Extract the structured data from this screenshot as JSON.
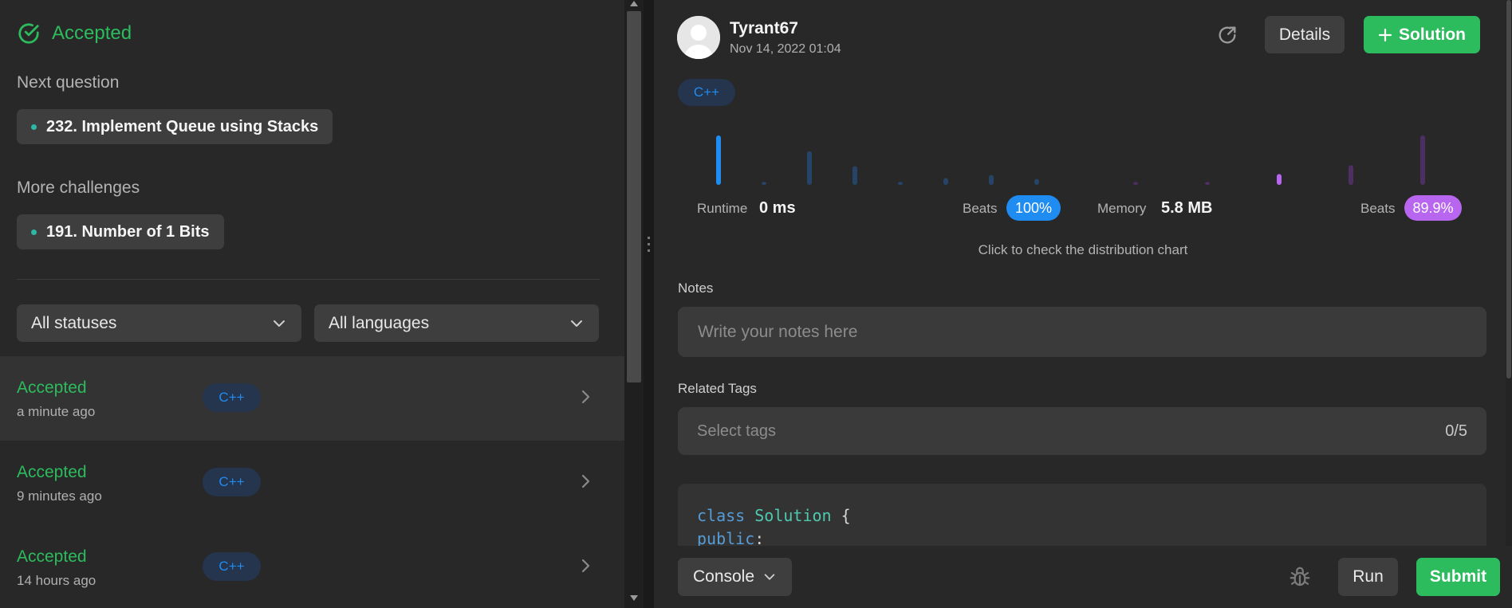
{
  "colors": {
    "accepted_green": "#2cbb5d",
    "lang_blue": "#1f8cf2",
    "runtime_beats": "#1f8cf2",
    "memory_beats": "#b865f0",
    "panel": "#282828"
  },
  "result": {
    "status": "Accepted",
    "icon": "check-circle-icon"
  },
  "next_question": {
    "label": "Next question",
    "title": "232. Implement Queue using Stacks"
  },
  "more_challenges": {
    "label": "More challenges",
    "title": "191. Number of 1 Bits"
  },
  "filters": {
    "status": "All statuses",
    "language": "All languages"
  },
  "submissions": [
    {
      "status": "Accepted",
      "time": "a minute ago",
      "lang": "C++",
      "selected": true
    },
    {
      "status": "Accepted",
      "time": "9 minutes ago",
      "lang": "C++",
      "selected": false
    },
    {
      "status": "Accepted",
      "time": "14 hours ago",
      "lang": "C++",
      "selected": false
    }
  ],
  "detail": {
    "username": "Tyrant67",
    "date": "Nov 14, 2022 01:04",
    "details_label": "Details",
    "solution_label": "Solution",
    "lang": "C++"
  },
  "runtime": {
    "label": "Runtime",
    "value": "0 ms",
    "beats_label": "Beats",
    "beats": "100%"
  },
  "memory": {
    "label": "Memory",
    "value": "5.8 MB",
    "beats_label": "Beats",
    "beats": "89.9%"
  },
  "distribution": {
    "hint": "Click to check the distribution chart",
    "runtime_bars": [
      1.0,
      0.06,
      0.68,
      0.38,
      0.06,
      0.14,
      0.2,
      0.12
    ],
    "runtime_highlight": 0,
    "memory_bars": [
      0.06,
      0.06,
      0.22,
      0.4,
      1.0
    ],
    "memory_highlight": 2
  },
  "notes": {
    "label": "Notes",
    "placeholder": "Write your notes here"
  },
  "tags": {
    "label": "Related Tags",
    "placeholder": "Select tags",
    "count": "0/5"
  },
  "code": {
    "line1_kw": "class",
    "line1_cls": "Solution",
    "line1_rest": " {",
    "line2_kw": "public",
    "line2_rest": ":"
  },
  "bottom": {
    "console": "Console",
    "run": "Run",
    "submit": "Submit"
  }
}
